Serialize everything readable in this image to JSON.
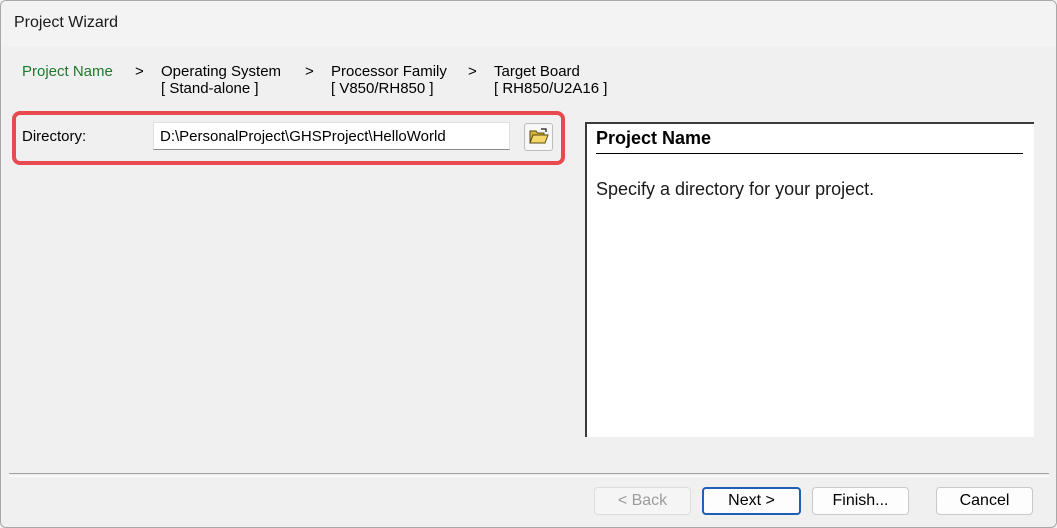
{
  "window": {
    "title": "Project Wizard"
  },
  "steps": [
    {
      "name": "Project Name",
      "value": ""
    },
    {
      "name": "Operating System",
      "value": "[ Stand-alone ]"
    },
    {
      "name": "Processor Family",
      "value": "[ V850/RH850 ]"
    },
    {
      "name": "Target Board",
      "value": "[ RH850/U2A16 ]"
    }
  ],
  "step_separator": ">",
  "directory": {
    "label": "Directory:",
    "value": "D:\\PersonalProject\\GHSProject\\HelloWorld"
  },
  "info": {
    "title": "Project Name",
    "text": "Specify a directory for your project."
  },
  "buttons": {
    "back": "< Back",
    "next": "Next >",
    "finish": "Finish...",
    "cancel": "Cancel"
  },
  "colors": {
    "active_step": "#1e7a2a",
    "highlight": "#e84a4f"
  }
}
